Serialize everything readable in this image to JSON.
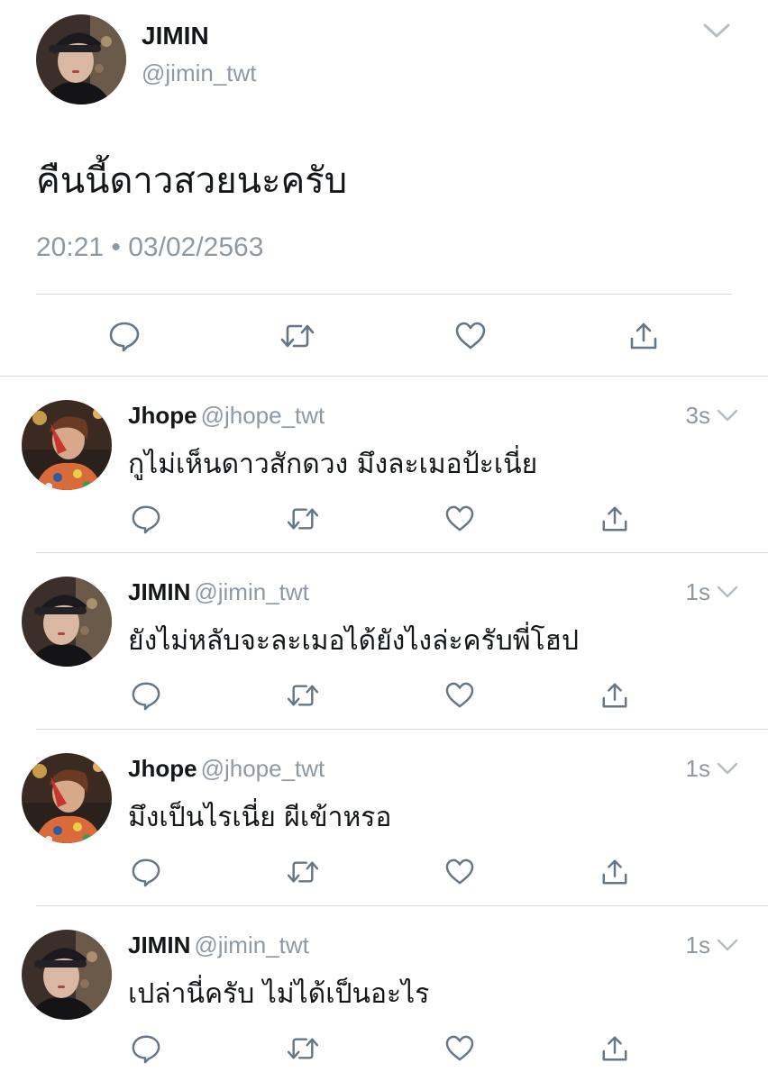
{
  "main_tweet": {
    "author_name": "JIMIN",
    "author_handle": "@jimin_twt",
    "text": "คืนนี้ดาวสวยนะครับ",
    "timestamp": "20:21 • 03/02/2563",
    "avatar": "jimin-avatar",
    "actions": [
      "reply-icon",
      "retweet-icon",
      "like-icon",
      "share-icon"
    ]
  },
  "replies": [
    {
      "author_name": "Jhope",
      "author_handle": "@jhope_twt",
      "time": "3s",
      "text": "กูไม่เห็นดาวสักดวง มึงละเมอป้ะเนี่ย",
      "avatar": "jhope-avatar"
    },
    {
      "author_name": "JIMIN",
      "author_handle": "@jimin_twt",
      "time": "1s",
      "text": "ยังไม่หลับจะละเมอได้ยังไงล่ะครับพี่โฮป",
      "avatar": "jimin-avatar"
    },
    {
      "author_name": "Jhope",
      "author_handle": "@jhope_twt",
      "time": "1s",
      "text": "มึงเป็นไรเนี่ย ผีเข้าหรอ",
      "avatar": "jhope-avatar"
    },
    {
      "author_name": "JIMIN",
      "author_handle": "@jimin_twt",
      "time": "1s",
      "text": "เปล่านี่ครับ ไม่ได้เป็นอะไร",
      "avatar": "jimin-avatar"
    }
  ],
  "colors": {
    "text_primary": "#14171a",
    "text_secondary": "#8e99a4",
    "icon": "#657786",
    "divider": "#d6dbdf"
  }
}
